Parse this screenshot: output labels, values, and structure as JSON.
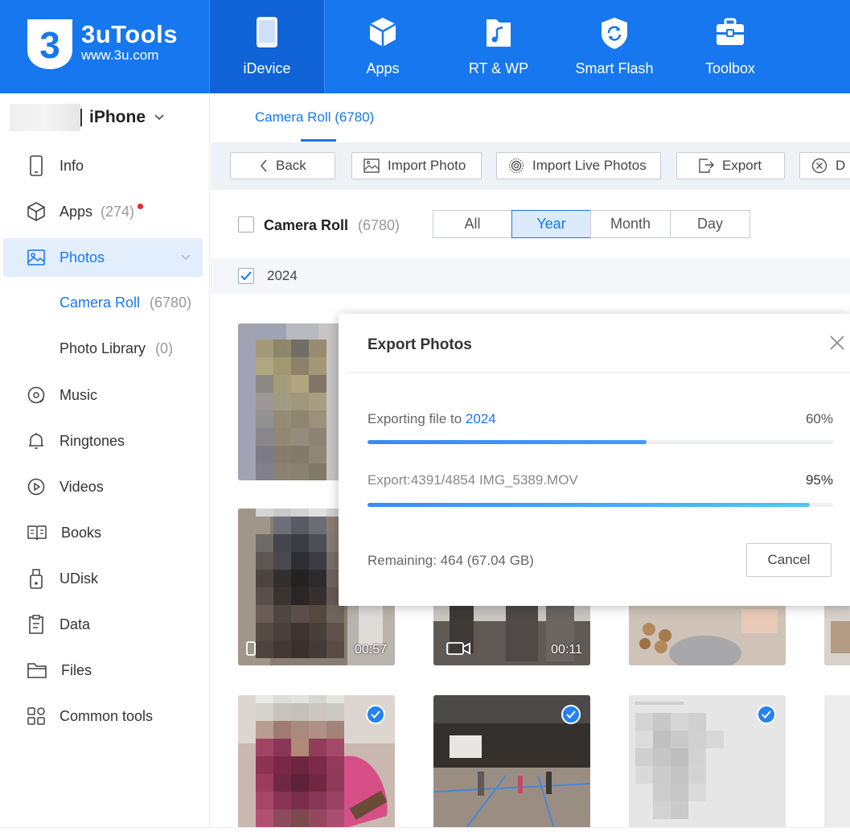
{
  "brand": {
    "name": "3uTools",
    "url": "www.3u.com",
    "color": "#1677ee"
  },
  "nav": [
    {
      "label": "iDevice",
      "icon": "phone-icon",
      "active": true
    },
    {
      "label": "Apps",
      "icon": "cube-icon"
    },
    {
      "label": "RT & WP",
      "icon": "music-file-icon"
    },
    {
      "label": "Smart Flash",
      "icon": "shield-refresh-icon"
    },
    {
      "label": "Toolbox",
      "icon": "toolbox-icon"
    }
  ],
  "device": {
    "name": "iPhone"
  },
  "sidebar": {
    "items": [
      {
        "label": "Info",
        "icon": "phone-outline-icon"
      },
      {
        "label": "Apps",
        "count": "(274)",
        "icon": "cube-outline-icon",
        "badge": true
      },
      {
        "label": "Photos",
        "icon": "image-icon",
        "active": true
      },
      {
        "label": "Music",
        "icon": "disc-icon"
      },
      {
        "label": "Ringtones",
        "icon": "bell-icon"
      },
      {
        "label": "Videos",
        "icon": "play-circle-icon"
      },
      {
        "label": "Books",
        "icon": "book-icon"
      },
      {
        "label": "UDisk",
        "icon": "usb-icon"
      },
      {
        "label": "Data",
        "icon": "clipboard-icon"
      },
      {
        "label": "Files",
        "icon": "folder-icon"
      },
      {
        "label": "Common tools",
        "icon": "grid-icon"
      }
    ],
    "sub": [
      {
        "label": "Camera Roll",
        "count": "(6780)",
        "active": true
      },
      {
        "label": "Photo Library",
        "count": "(0)"
      }
    ]
  },
  "tabs": {
    "active": "Camera Roll (6780)"
  },
  "toolbar": {
    "back": "Back",
    "import_photo": "Import Photo",
    "import_live": "Import Live Photos",
    "export": "Export",
    "delete_partial": "D"
  },
  "filter": {
    "label": "Camera Roll",
    "count": "(6780)",
    "segments": [
      "All",
      "Year",
      "Month",
      "Day"
    ],
    "selected": "Year"
  },
  "group": {
    "year": "2024"
  },
  "thumbs": [
    {
      "duration": "00:57"
    },
    {
      "duration": "00:11"
    }
  ],
  "dialog": {
    "title": "Export Photos",
    "line1_prefix": "Exporting file to ",
    "line1_target": "2024",
    "line1_pct": "60%",
    "line1_progress": 0.6,
    "line2": "Export:4391/4854 IMG_5389.MOV",
    "line2_pct": "95%",
    "line2_progress": 0.95,
    "remaining": "Remaining: 464 (67.04 GB)",
    "cancel": "Cancel"
  }
}
